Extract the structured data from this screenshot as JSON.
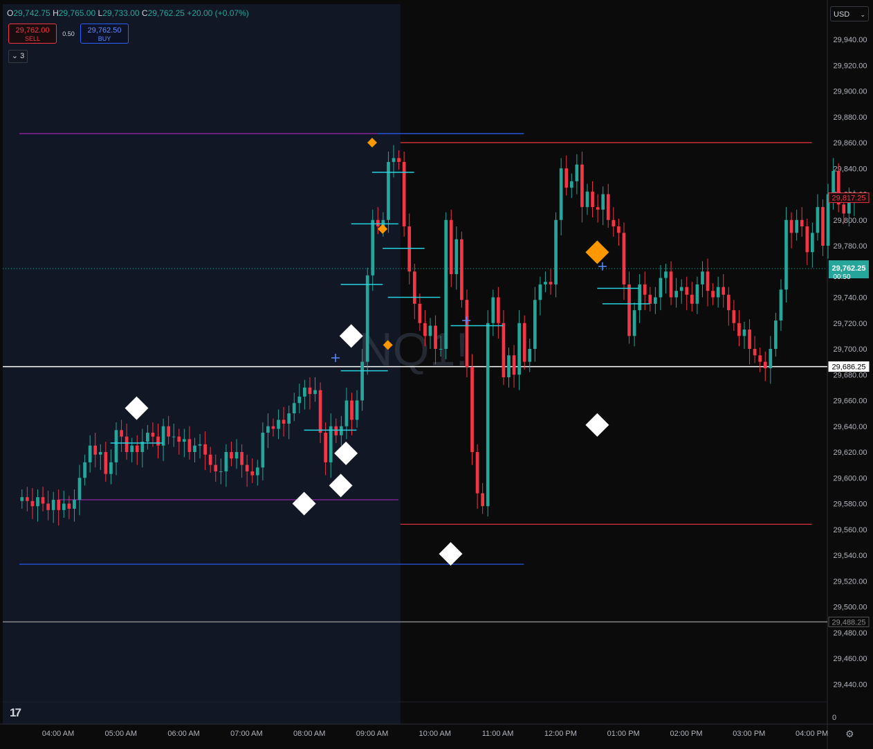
{
  "header": {
    "o_label": "O",
    "o_value": "29,742.75",
    "h_label": "H",
    "h_value": "29,765.00",
    "l_label": "L",
    "l_value": "29,733.00",
    "c_label": "C",
    "c_value": "29,762.25",
    "change": "+20.00 (+0.07%)"
  },
  "trade": {
    "sell_price": "29,762.00",
    "sell_label": "SELL",
    "spread": "0.50",
    "buy_price": "29,762.50",
    "buy_label": "BUY"
  },
  "indicators_toggle": {
    "count": "3"
  },
  "currency": "USD",
  "scale_zero": "0",
  "colors": {
    "up": "#26a69a",
    "down": "#f23645",
    "background": "#0b0b0b",
    "session_shade": "#121725",
    "cyan": "#26d4e0",
    "purple": "#9c27b0",
    "blue": "#2962ff",
    "orange": "#ff9800",
    "white": "#ffffff"
  },
  "icons": {
    "logo": "tradingview-logo",
    "settings": "gear-icon",
    "chevron": "chevron-down-icon"
  },
  "chart_data": {
    "type": "candlestick",
    "watermark": "NQ1!",
    "y_ticks": [
      29940,
      29920,
      29900,
      29880,
      29860,
      29840,
      29820,
      29800,
      29780,
      29760,
      29740,
      29720,
      29700,
      29680,
      29660,
      29640,
      29620,
      29600,
      29580,
      29560,
      29540,
      29520,
      29500,
      29480,
      29460,
      29440
    ],
    "x_ticks": [
      "04:00 AM",
      "05:00 AM",
      "06:00 AM",
      "07:00 AM",
      "08:00 AM",
      "09:00 AM",
      "10:00 AM",
      "11:00 AM",
      "12:00 PM",
      "01:00 PM",
      "02:00 PM",
      "03:00 PM",
      "04:00 PM"
    ],
    "x_start": "03:23 AM",
    "candle_minutes": 5,
    "candles_close": [
      29585,
      29582,
      29578,
      29585,
      29580,
      29575,
      29583,
      29575,
      29580,
      29576,
      29583,
      29600,
      29612,
      29625,
      29618,
      29620,
      29603,
      29612,
      29637,
      29632,
      29620,
      29625,
      29620,
      29628,
      29635,
      29632,
      29625,
      29640,
      29632,
      29632,
      29628,
      29630,
      29620,
      29625,
      29626,
      29618,
      29610,
      29605,
      29605,
      29620,
      29615,
      29620,
      29610,
      29605,
      29602,
      29608,
      29635,
      29640,
      29638,
      29645,
      29642,
      29650,
      29658,
      29663,
      29670,
      29665,
      29668,
      29635,
      29612,
      29640,
      29633,
      29640,
      29660,
      29645,
      29660,
      29690,
      29757,
      29800,
      29795,
      29800,
      29845,
      29848,
      29845,
      29795,
      29760,
      29735,
      29720,
      29710,
      29718,
      29700,
      29700,
      29800,
      29758,
      29785,
      29738,
      29686,
      29620,
      29588,
      29578,
      29720,
      29740,
      29720,
      29678,
      29695,
      29680,
      29720,
      29690,
      29700,
      29738,
      29750,
      29752,
      29750,
      29800,
      29840,
      29825,
      29830,
      29843,
      29810,
      29822,
      29810,
      29808,
      29820,
      29800,
      29795,
      29790,
      29750,
      29710,
      29730,
      29750,
      29742,
      29735,
      29740,
      29755,
      29760,
      29740,
      29745,
      29748,
      29742,
      29735,
      29750,
      29760,
      29745,
      29740,
      29748,
      29742,
      29730,
      29720,
      29710,
      29715,
      29700,
      29695,
      29690,
      29685,
      29700,
      29722,
      29746,
      29800,
      29790,
      29800,
      29795,
      29775,
      29790,
      29810,
      29780,
      29820,
      29838,
      29812,
      29805,
      29815,
      29817
    ],
    "last_price": "29,762.25",
    "countdown": "00:50",
    "price_labels": [
      {
        "value": 29817.25,
        "text": "29,817.25",
        "style": "red"
      },
      {
        "value": 29686.25,
        "text": "29,686.25",
        "style": "white"
      },
      {
        "value": 29488.25,
        "text": "29,488.25",
        "style": "gray"
      }
    ],
    "levels": [
      {
        "price": 29867,
        "color": "purple",
        "from": "03:23 AM",
        "to": "09:05 AM"
      },
      {
        "price": 29867,
        "color": "blue",
        "from": "09:05 AM",
        "to": "11:25 AM"
      },
      {
        "price": 29583,
        "color": "purple",
        "from": "04:00 AM",
        "to": "09:25 AM"
      },
      {
        "price": 29533,
        "color": "blue",
        "from": "03:23 AM",
        "to": "11:25 AM"
      },
      {
        "price": 29860,
        "color": "red",
        "from": "09:27 AM",
        "to": "04:00 PM"
      },
      {
        "price": 29564,
        "color": "red",
        "from": "09:27 AM",
        "to": "04:00 PM"
      }
    ],
    "cyan_levels": [
      {
        "price": 29627,
        "from": "04:50 AM",
        "to": "05:40 AM"
      },
      {
        "price": 29637,
        "from": "07:55 AM",
        "to": "08:45 AM"
      },
      {
        "price": 29683,
        "from": "08:30 AM",
        "to": "09:15 AM"
      },
      {
        "price": 29797,
        "from": "08:40 AM",
        "to": "09:25 AM"
      },
      {
        "price": 29750,
        "from": "08:30 AM",
        "to": "09:10 AM"
      },
      {
        "price": 29837,
        "from": "09:00 AM",
        "to": "09:40 AM"
      },
      {
        "price": 29778,
        "from": "09:10 AM",
        "to": "09:50 AM"
      },
      {
        "price": 29740,
        "from": "09:15 AM",
        "to": "10:05 AM"
      },
      {
        "price": 29718,
        "from": "10:15 AM",
        "to": "11:05 AM"
      },
      {
        "price": 29747,
        "from": "12:35 PM",
        "to": "01:15 PM"
      },
      {
        "price": 29735,
        "from": "12:40 PM",
        "to": "01:25 PM"
      }
    ],
    "markers": [
      {
        "time": "05:15 AM",
        "price": 29654,
        "shape": "diamond",
        "color": "white",
        "size": "large"
      },
      {
        "time": "08:40 AM",
        "price": 29710,
        "shape": "diamond",
        "color": "white",
        "size": "large"
      },
      {
        "time": "08:35 AM",
        "price": 29619,
        "shape": "diamond",
        "color": "white",
        "size": "large"
      },
      {
        "time": "08:30 AM",
        "price": 29594,
        "shape": "diamond",
        "color": "white",
        "size": "large"
      },
      {
        "time": "07:55 AM",
        "price": 29580,
        "shape": "diamond",
        "color": "white",
        "size": "large"
      },
      {
        "time": "10:15 AM",
        "price": 29541,
        "shape": "diamond",
        "color": "white",
        "size": "large"
      },
      {
        "time": "12:35 PM",
        "price": 29641,
        "shape": "diamond",
        "color": "white",
        "size": "large"
      },
      {
        "time": "09:00 AM",
        "price": 29860,
        "shape": "diamond",
        "color": "orange",
        "size": "small"
      },
      {
        "time": "09:10 AM",
        "price": 29793,
        "shape": "diamond",
        "color": "orange",
        "size": "small"
      },
      {
        "time": "09:15 AM",
        "price": 29703,
        "shape": "diamond",
        "color": "orange",
        "size": "small"
      },
      {
        "time": "12:35 PM",
        "price": 29775,
        "shape": "diamond",
        "color": "orange",
        "size": "large"
      },
      {
        "time": "08:25 AM",
        "price": 29693,
        "shape": "cross",
        "color": "blue"
      },
      {
        "time": "10:30 AM",
        "price": 29722,
        "shape": "cross",
        "color": "blue"
      },
      {
        "time": "12:40 PM",
        "price": 29764,
        "shape": "cross",
        "color": "blue"
      }
    ],
    "session_shade": {
      "from": "03:23 AM",
      "to": "09:27 AM"
    },
    "ylim": [
      29425,
      29965
    ]
  }
}
